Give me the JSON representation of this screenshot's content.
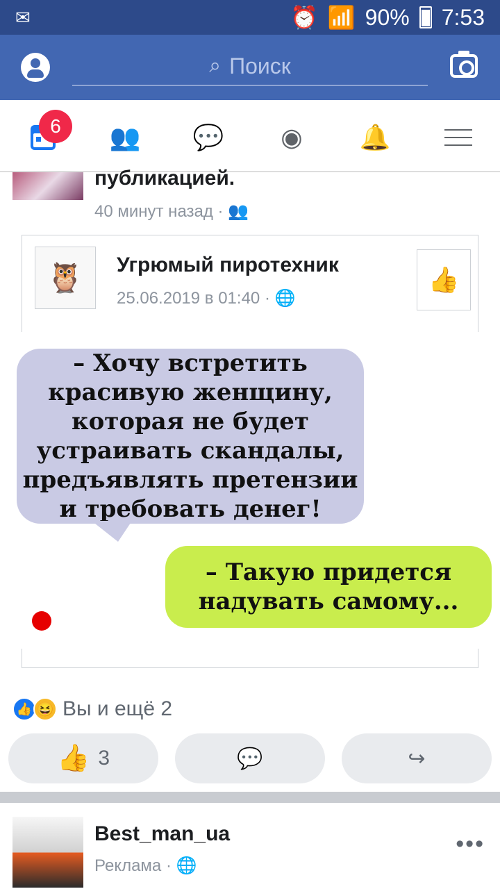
{
  "status_bar": {
    "battery_percent": "90%",
    "time": "7:53"
  },
  "top_bar": {
    "search_placeholder": "Поиск"
  },
  "nav": {
    "notifications_badge": "6"
  },
  "post": {
    "share_text": "публикацией.",
    "share_time": "40 минут назад",
    "shared_page": {
      "name": "Угрюмый пиротехник",
      "date": "25.06.2019 в 01:40"
    },
    "meme": {
      "blue_text": "– Хочу встретить красивую женщину, которая не будет устраивать скандалы, предъявлять претензии и требовать денег!",
      "green_text": "– Такую придется надувать самому..."
    },
    "reactions_text": "Вы и ещё 2",
    "like_count": "3"
  },
  "ad": {
    "name": "Best_man_ua",
    "label": "Реклама"
  },
  "colors": {
    "header_blue": "#4267b2",
    "badge_red": "#f02849",
    "like_blue": "#1877f2",
    "meme_blue": "#c9cae4",
    "meme_green": "#c9ed4d"
  }
}
